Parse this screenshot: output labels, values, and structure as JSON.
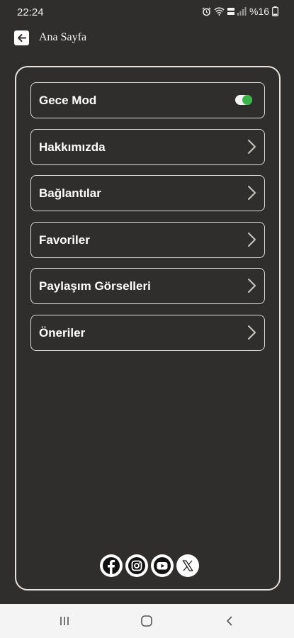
{
  "status_bar": {
    "time": "22:24",
    "battery_text": "%16",
    "icons": [
      "alarm-icon",
      "wifi-icon",
      "volte-icon",
      "signal-icon",
      "battery-icon"
    ]
  },
  "header": {
    "title": "Ana Sayfa",
    "back_icon": "arrow-left-icon"
  },
  "menu": {
    "items": [
      {
        "label": "Gece Mod",
        "control": "toggle",
        "toggle_on": true
      },
      {
        "label": "Hakkımızda",
        "control": "chevron"
      },
      {
        "label": "Bağlantılar",
        "control": "chevron"
      },
      {
        "label": "Favoriler",
        "control": "chevron"
      },
      {
        "label": "Paylaşım Görselleri",
        "control": "chevron"
      },
      {
        "label": "Öneriler",
        "control": "chevron"
      }
    ]
  },
  "social": [
    "facebook-icon",
    "instagram-icon",
    "youtube-icon",
    "x-icon"
  ],
  "nav_bar": [
    "recent-apps-icon",
    "home-icon",
    "back-icon"
  ],
  "colors": {
    "background": "#302e2c",
    "border": "#dedad6",
    "toggle_on": "#39b54a",
    "nav_bar": "#f4f4f4"
  }
}
